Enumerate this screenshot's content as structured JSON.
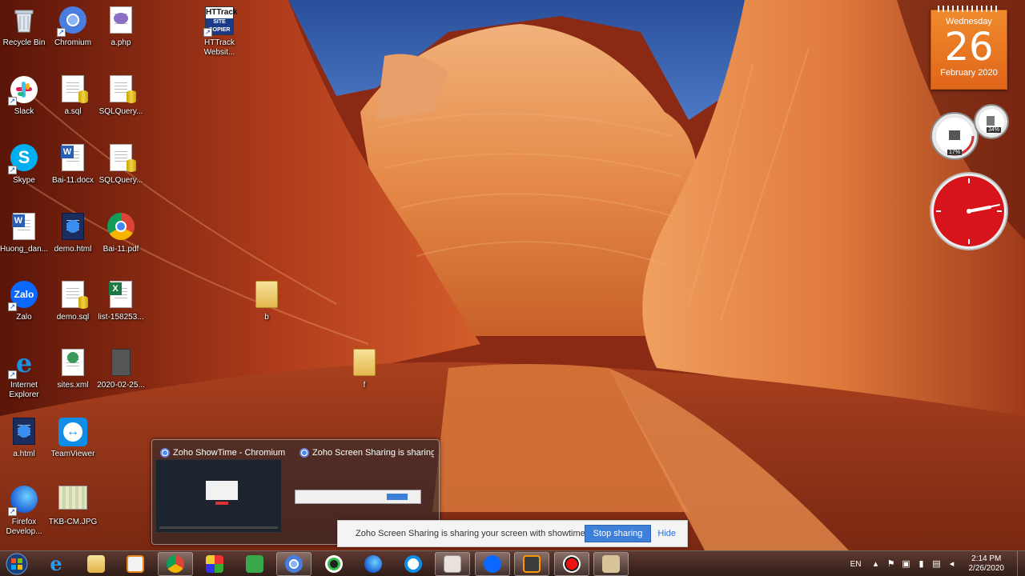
{
  "desktop": {
    "icons": [
      {
        "label": "Recycle Bin",
        "icon": "recycle-bin-icon"
      },
      {
        "label": "Chromium",
        "icon": "chromium-icon"
      },
      {
        "label": "a.php",
        "icon": "php-file-icon"
      },
      {
        "label": "HTTrack Websit...",
        "icon": "httrack-icon"
      },
      {
        "label": "Slack",
        "icon": "slack-icon"
      },
      {
        "label": "a.sql",
        "icon": "sql-file-icon"
      },
      {
        "label": "SQLQuery...",
        "icon": "sql-file-icon"
      },
      {
        "label": "Skype",
        "icon": "skype-icon"
      },
      {
        "label": "Bai-11.docx",
        "icon": "word-document-icon"
      },
      {
        "label": "SQLQuery...",
        "icon": "sql-file-icon"
      },
      {
        "label": "Huong_dan...",
        "icon": "word-document-icon"
      },
      {
        "label": "demo.html",
        "icon": "html-file-icon"
      },
      {
        "label": "Bai-11.pdf",
        "icon": "chrome-pdf-icon"
      },
      {
        "label": "Zalo",
        "icon": "zalo-icon"
      },
      {
        "label": "demo.sql",
        "icon": "sql-file-icon"
      },
      {
        "label": "list-158253...",
        "icon": "excel-file-icon"
      },
      {
        "label": "b",
        "icon": "folder-icon"
      },
      {
        "label": "Internet Explorer",
        "icon": "internet-explorer-icon"
      },
      {
        "label": "sites.xml",
        "icon": "xml-file-icon"
      },
      {
        "label": "2020-02-25...",
        "icon": "image-file-icon"
      },
      {
        "label": "f",
        "icon": "folder-icon"
      },
      {
        "label": "a.html",
        "icon": "html-file-icon"
      },
      {
        "label": "TeamViewer",
        "icon": "teamviewer-icon"
      },
      {
        "label": "Firefox Develop...",
        "icon": "firefox-developer-icon"
      },
      {
        "label": "TKB-CM.JPG",
        "icon": "image-file-icon"
      }
    ]
  },
  "gadgets": {
    "calendar": {
      "weekday": "Wednesday",
      "day": "26",
      "month": "February 2020"
    },
    "meter": {
      "cpu": "17%",
      "memory": "34%"
    }
  },
  "thumbnails": {
    "items": [
      {
        "title": "Zoho ShowTime - Chromium"
      },
      {
        "title": "Zoho Screen Sharing is sharing ..."
      }
    ]
  },
  "sharebar": {
    "message": "Zoho Screen Sharing is sharing your screen with showtime.zoho.com.",
    "stop_label": "Stop sharing",
    "hide_label": "Hide"
  },
  "taskbar": {
    "apps": [
      "internet-explorer-icon",
      "file-explorer-icon",
      "media-player-icon",
      "chrome-icon",
      "paint-icon",
      "notepad-plus-icon",
      "chromium-icon",
      "obs-icon",
      "firefox-icon",
      "teamviewer-icon",
      "screen-tools-icon",
      "zalo-icon",
      "sublime-text-icon",
      "record-icon",
      "settings-tools-icon"
    ],
    "language": "EN",
    "time": "2:14 PM",
    "date": "2/26/2020"
  }
}
